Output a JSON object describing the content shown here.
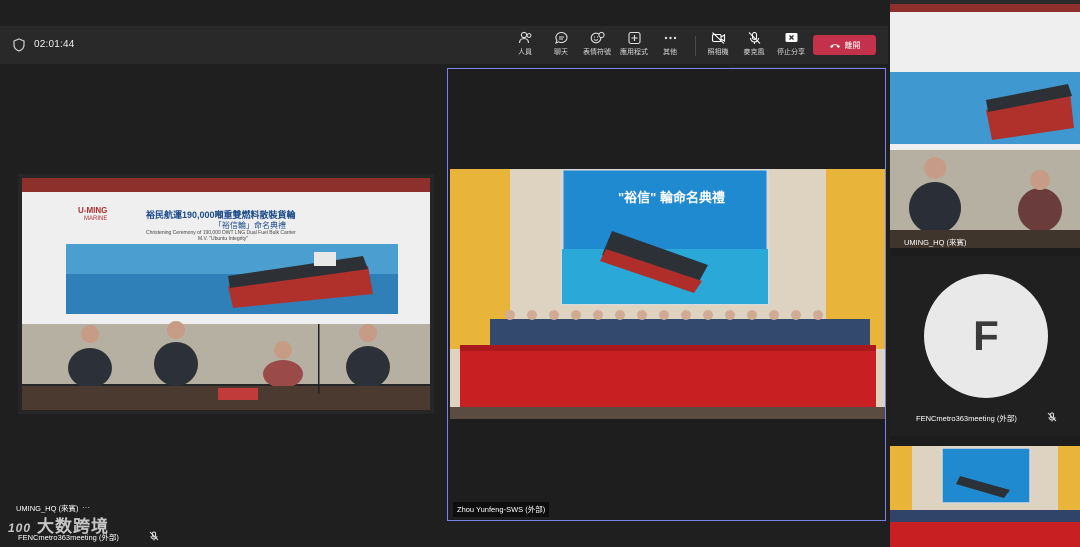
{
  "meeting": {
    "timer": "02:01:44",
    "toolbar": {
      "people": "人員",
      "chat": "聊天",
      "reactions": "表情符號",
      "apps": "應用程式",
      "more": "其他",
      "camera": "照相機",
      "mic": "麥克風",
      "share": "停止分享",
      "leave": "離開"
    }
  },
  "self_tile": {
    "initial": "F"
  },
  "tiles": {
    "left": {
      "name": "UMING_HQ (來賓)",
      "banner_title": "裕民航運190,000噸重雙燃料散裝貨輪",
      "banner_sub": "「裕信輪」命名典禮",
      "banner_en1": "Christening Ceremony of 190,000 DWT LNG Dual Fuel Bulk Carrier",
      "banner_en2": "M.V. \"Ubuntu Integrity\"",
      "brand1": "U-MING",
      "brand2": "MARINE"
    },
    "center": {
      "name": "Zhou Yunfeng-SWS (外部)",
      "screen_title": "\"裕信\" 輪命名典禮"
    },
    "right_top": {
      "name": "UMING_HQ (來賓)"
    },
    "right_mid": {
      "name": "FENCmetro363meeting (外部)",
      "initial": "F"
    },
    "bottom_left": {
      "name": "FENCmetro363meeting (外部)"
    }
  },
  "watermark": {
    "logo": "100",
    "text": "大数跨境"
  },
  "colors": {
    "leave": "#c4314b",
    "tablecloth": "#c81f23",
    "curtain": "#e8b53a",
    "active_border": "#7b83eb"
  }
}
